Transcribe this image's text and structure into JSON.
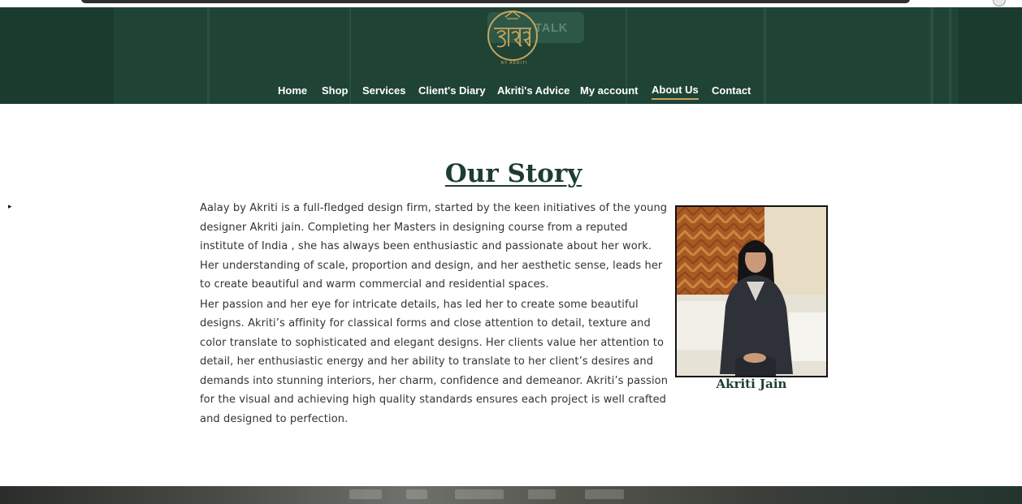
{
  "header": {
    "talk_button": "TALK",
    "logo_caption": "BY AKRITI"
  },
  "nav": {
    "items": [
      {
        "label": "Home"
      },
      {
        "label": "Shop"
      },
      {
        "label": "Services"
      },
      {
        "label": "Client's Diary"
      },
      {
        "label": "Akriti's Advice"
      },
      {
        "label": "My account"
      },
      {
        "label": "About Us",
        "active": true
      },
      {
        "label": "Contact"
      }
    ]
  },
  "main": {
    "title": "Our Story",
    "paragraphs": [
      "Aalay by Akriti is a full-fledged design firm, started by the keen initiatives of the young designer Akriti jain. Completing her Masters in designing course from a reputed institute of India , she has always been enthusiastic and passionate about her work. Her understanding of scale, proportion and design, and her aesthetic sense, leads her to create beautiful and warm commercial and residential spaces.",
      "Her passion and her eye for intricate details, has led her to create some beautiful designs. Akriti’s affinity for classical forms and close attention to detail, texture and color translate to sophisticated and elegant designs. Her clients value her attention to detail, her enthusiastic energy and her ability to translate to her client’s desires and demands into stunning interiors, her charm, confidence and demeanor. Akriti’s passion for the visual and achieving high quality standards ensures each project is well crafted and designed to perfection."
    ],
    "portrait_caption": "Akriti Jain"
  },
  "colors": {
    "header_bg": "#1f4436",
    "accent_gold": "#c9a45c",
    "title_green": "#1c3d30",
    "body_text": "#333333"
  },
  "icons": {
    "cursor": "small-pointer-icon",
    "logo": "aalay-logo-icon"
  }
}
